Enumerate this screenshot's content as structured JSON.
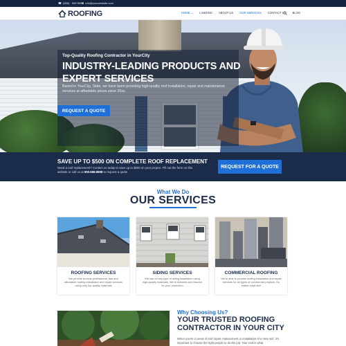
{
  "topbar": {
    "phone": "(555) · 555·5555",
    "email": "info@yourwebsite.com",
    "phone_icon": "phone-icon",
    "email_icon": "mail-icon"
  },
  "header": {
    "logo_text": "ROOFING",
    "logo_icon": "house-roof-icon",
    "nav": [
      {
        "label": "HOME",
        "active": true
      },
      {
        "label": "LANDING",
        "active": false
      },
      {
        "label": "ABOUT US",
        "active": false
      },
      {
        "label": "OUR SERVICES",
        "active": false
      },
      {
        "label": "CONTACT US",
        "active": false
      },
      {
        "label": "BLOG",
        "active": false
      }
    ],
    "home_chevron": "chevron-down-icon",
    "search_icon": "search-icon"
  },
  "hero": {
    "kicker": "Top-Quality Roofing Contractor in YourCity",
    "title": "INDUSTRY-LEADING PRODUCTS AND EXPERT SERVICES",
    "body": "Based in YourCity, State, we have been providing high-quality roof installation, repair and maintenance services at affordable prices since 20xx.",
    "cta": "REQUEST A QUOTE"
  },
  "promo": {
    "title": "SAVE UP TO $500 ON COMPLETE ROOF REPLACEMENT",
    "body_pre": "Need a roof replacement? Contact us today to save up to $500 on your project. Fill out the form on this website or call us at",
    "phone": "800.888.8888",
    "body_post": "to request a quote",
    "cta": "REQUEST FOR A QUOTE"
  },
  "services": {
    "kicker": "What We Do",
    "title": "OUR SERVICES",
    "cards": [
      {
        "title": "ROOFING SERVICES",
        "body": "We provide provide professional, fast and affordable roofing installation and repair services using only top quality materials"
      },
      {
        "title": "SIDING SERVICES",
        "body": "We can do any type of siding installation using high-quality materials. We're licensed and insured for your protection"
      },
      {
        "title": "COMMERCIAL ROOFING",
        "body": "We're able to provide roofing installation and repair services for all types of commercial projects. No matter what size"
      }
    ]
  },
  "why": {
    "kicker": "Why Choosing Us?",
    "title": "YOUR TRUSTED ROOFING CONTRACTOR IN YOUR CITY",
    "body": "When you're in need of roof repair, replacement or installation of a new roof, it's important to choose the right people to do the job. Your roof is what"
  },
  "colors": {
    "navy": "#1b2b4a",
    "accent_blue": "#1f6fd8",
    "topbar": "#14233f"
  }
}
